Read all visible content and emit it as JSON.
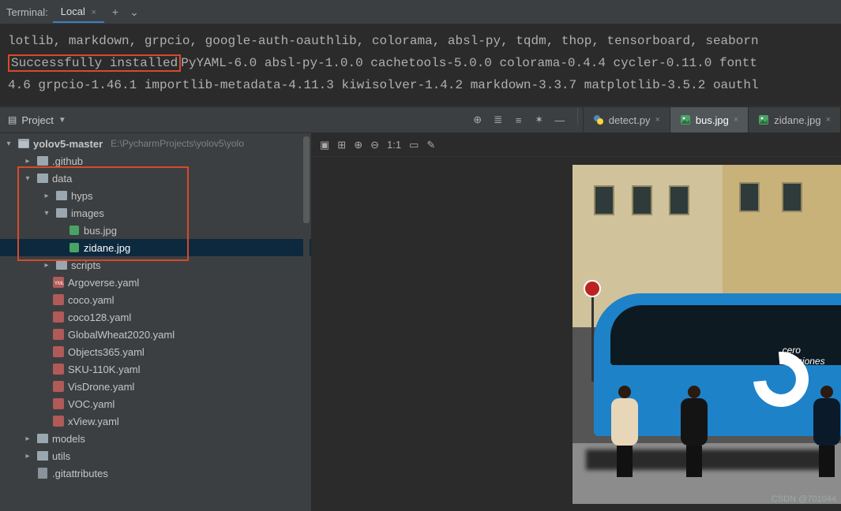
{
  "terminal": {
    "title": "Terminal:",
    "tab_label": "Local",
    "lines": {
      "l1": "lotlib, markdown, grpcio, google-auth-oauthlib, colorama, absl-py, tqdm, thop, tensorboard, seaborn",
      "l2_hl": "Successfully installed",
      "l2_rest": "PyYAML-6.0 absl-py-1.0.0 cachetools-5.0.0 colorama-0.4.4 cycler-0.11.0 fontt",
      "l3": "4.6 grpcio-1.46.1 importlib-metadata-4.11.3 kiwisolver-1.4.2 markdown-3.3.7 matplotlib-3.5.2 oauthl"
    }
  },
  "project_panel": {
    "button_label": "Project"
  },
  "editor_tabs": {
    "t0": "detect.py",
    "t1": "bus.jpg",
    "t2": "zidane.jpg"
  },
  "image_toolbar": {
    "ratio": "1:1"
  },
  "tree": {
    "root": "yolov5-master",
    "root_path": "E:\\PycharmProjects\\yolov5\\yolo",
    "github": ".github",
    "data": "data",
    "hyps": "hyps",
    "images": "images",
    "bus": "bus.jpg",
    "zidane": "zidane.jpg",
    "scripts": "scripts",
    "argoverse": "Argoverse.yaml",
    "coco": "coco.yaml",
    "coco128": "coco128.yaml",
    "gw": "GlobalWheat2020.yaml",
    "obj365": "Objects365.yaml",
    "sku": "SKU-110K.yaml",
    "vis": "VisDrone.yaml",
    "voc": "VOC.yaml",
    "xview": "xView.yaml",
    "models": "models",
    "utils": "utils",
    "gitattr": ".gitattributes"
  },
  "bus_caption": {
    "cero": "cero",
    "emis": "emisiones"
  },
  "watermark": "CSDN @701044"
}
